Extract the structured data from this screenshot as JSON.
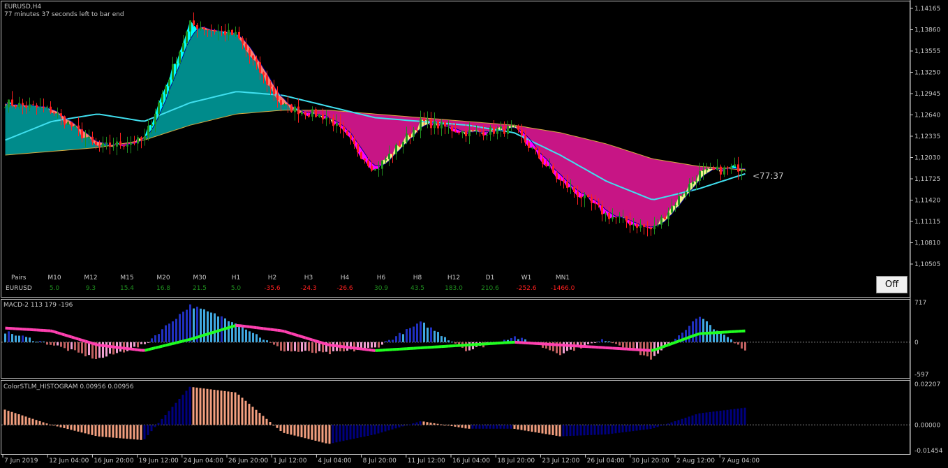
{
  "colors": {
    "background": "#000000",
    "grid_line": "#c8c8c8",
    "bull_candle": "#1f8f1f",
    "bear_candle": "#ff2020",
    "cyan_band": "#00ffff",
    "teal_fill": "#008b8b",
    "magenta_fill": "#c71585",
    "pink_band": "#ff00ff",
    "salmon_band": "#fa8072",
    "khaki_band": "#f0f08c",
    "ma_fast": "#40e0f0",
    "ma_slow": "#d4aa40",
    "navy_line": "#00008b",
    "macd_up_hist": "#2030c0",
    "macd_up_hist_light": "#40a8e0",
    "macd_dn_hist": "#c06060",
    "macd_dn_hist_light": "#f0a0d0",
    "macd_signal_up": "#20ff20",
    "macd_signal_dn": "#ff40b0",
    "stlm_up": "#000080",
    "stlm_dn": "#f4a080",
    "table_positive": "#1f8f1f",
    "table_negative": "#ff2020"
  },
  "main": {
    "symbol": "EURUSD,H4",
    "timer_text": "77 minutes 37 seconds left to bar end",
    "countdown_label": "<77:37",
    "off_button": "Off",
    "price_axis": [
      "1,14165",
      "1,13860",
      "1,13555",
      "1,13250",
      "1,12945",
      "1,12640",
      "1,12335",
      "1,12030",
      "1,11725",
      "1,11420",
      "1,11115",
      "1,10810",
      "1,10505"
    ],
    "table": {
      "pairs_label": "Pairs",
      "symbol": "EURUSD",
      "columns": [
        {
          "tf": "M10",
          "value": "5.0"
        },
        {
          "tf": "M12",
          "value": "9.3"
        },
        {
          "tf": "M15",
          "value": "15.4"
        },
        {
          "tf": "M20",
          "value": "16.8"
        },
        {
          "tf": "M30",
          "value": "21.5"
        },
        {
          "tf": "H1",
          "value": "5.0"
        },
        {
          "tf": "H2",
          "value": "-35.6"
        },
        {
          "tf": "H3",
          "value": "-24.3"
        },
        {
          "tf": "H4",
          "value": "-26.6"
        },
        {
          "tf": "H6",
          "value": "30.9"
        },
        {
          "tf": "H8",
          "value": "43.5"
        },
        {
          "tf": "H12",
          "value": "183.0"
        },
        {
          "tf": "D1",
          "value": "210.6"
        },
        {
          "tf": "W1",
          "value": "-252.6"
        },
        {
          "tf": "MN1",
          "value": "-1466.0"
        }
      ]
    }
  },
  "macd": {
    "label": "MACD-2 113 179 -196",
    "axis": [
      "717",
      "0",
      "-597"
    ]
  },
  "stlm": {
    "label": "ColorSTLM_HISTOGRAM 0.00956 0.00956",
    "axis": [
      "0.02207",
      "0.00000",
      "-0.01454"
    ]
  },
  "time_axis": [
    "7 Jun 2019",
    "12 Jun 04:00",
    "16 Jun 20:00",
    "19 Jun 12:00",
    "24 Jun 04:00",
    "26 Jun 20:00",
    "1 Jul 12:00",
    "4 Jul 04:00",
    "8 Jul 20:00",
    "11 Jul 12:00",
    "16 Jul 04:00",
    "18 Jul 20:00",
    "23 Jul 12:00",
    "26 Jul 04:00",
    "30 Jul 20:00",
    "2 Aug 12:00",
    "7 Aug 04:00"
  ],
  "chart_data": [
    {
      "type": "line",
      "x": [
        "7 Jun 2019",
        "12 Jun 04:00",
        "16 Jun 20:00",
        "19 Jun 12:00",
        "24 Jun 04:00",
        "26 Jun 20:00",
        "1 Jul 12:00",
        "4 Jul 04:00",
        "8 Jul 20:00",
        "11 Jul 12:00",
        "16 Jul 04:00",
        "18 Jul 20:00",
        "23 Jul 12:00",
        "26 Jul 04:00",
        "30 Jul 20:00",
        "2 Aug 12:00",
        "7 Aug 04:00"
      ],
      "series": [
        {
          "name": "EURUSD close",
          "values": [
            1.129,
            1.128,
            1.123,
            1.124,
            1.1395,
            1.138,
            1.1285,
            1.127,
            1.12,
            1.1265,
            1.125,
            1.1255,
            1.1185,
            1.114,
            1.112,
            1.1195,
            1.1205
          ]
        },
        {
          "values": [
            1.124,
            1.1265,
            1.1275,
            1.1265,
            1.129,
            1.1305,
            1.13,
            1.1285,
            1.127,
            1.1265,
            1.126,
            1.125,
            1.122,
            1.1185,
            1.116,
            1.1175,
            1.1195
          ]
        },
        {
          "values": [
            1.122,
            1.1225,
            1.123,
            1.124,
            1.126,
            1.1275,
            1.128,
            1.128,
            1.1275,
            1.127,
            1.1265,
            1.126,
            1.125,
            1.1235,
            1.1215,
            1.1205,
            1.12
          ]
        }
      ],
      "ylim": [
        1.1035,
        1.142
      ]
    },
    {
      "type": "bar",
      "title": "MACD-2 113 179 -196",
      "x": [
        "7 Jun 2019",
        "12 Jun 04:00",
        "16 Jun 20:00",
        "19 Jun 12:00",
        "24 Jun 04:00",
        "26 Jun 20:00",
        "1 Jul 12:00",
        "4 Jul 04:00",
        "8 Jul 20:00",
        "11 Jul 12:00",
        "16 Jul 04:00",
        "18 Jul 20:00",
        "23 Jul 12:00",
        "26 Jul 04:00",
        "30 Jul 20:00",
        "2 Aug 12:00",
        "7 Aug 04:00"
      ],
      "series": [
        {
          "values": [
            180,
            -40,
            -300,
            -50,
            650,
            350,
            -150,
            -200,
            -100,
            350,
            -150,
            100,
            -200,
            50,
            -300,
            450,
            -150
          ]
        },
        {
          "values": [
            250,
            200,
            -50,
            -150,
            50,
            300,
            200,
            -50,
            -150,
            -100,
            -50,
            0,
            -50,
            -100,
            -150,
            150,
            200
          ]
        }
      ],
      "ylim": [
        -597,
        717
      ]
    },
    {
      "type": "bar",
      "title": "ColorSTLM_HISTOGRAM 0.00956 0.00956",
      "x": [
        "7 Jun 2019",
        "12 Jun 04:00",
        "16 Jun 20:00",
        "19 Jun 12:00",
        "24 Jun 04:00",
        "26 Jun 20:00",
        "1 Jul 12:00",
        "4 Jul 04:00",
        "8 Jul 20:00",
        "11 Jul 12:00",
        "16 Jul 04:00",
        "18 Jul 20:00",
        "23 Jul 12:00",
        "26 Jul 04:00",
        "30 Jul 20:00",
        "2 Aug 12:00",
        "7 Aug 04:00"
      ],
      "values": [
        0.008,
        0.0,
        -0.006,
        -0.008,
        0.02,
        0.017,
        -0.004,
        -0.01,
        -0.005,
        0.002,
        -0.002,
        -0.002,
        -0.006,
        -0.005,
        -0.002,
        0.006,
        0.009
      ],
      "ylim": [
        -0.01454,
        0.02207
      ]
    }
  ]
}
